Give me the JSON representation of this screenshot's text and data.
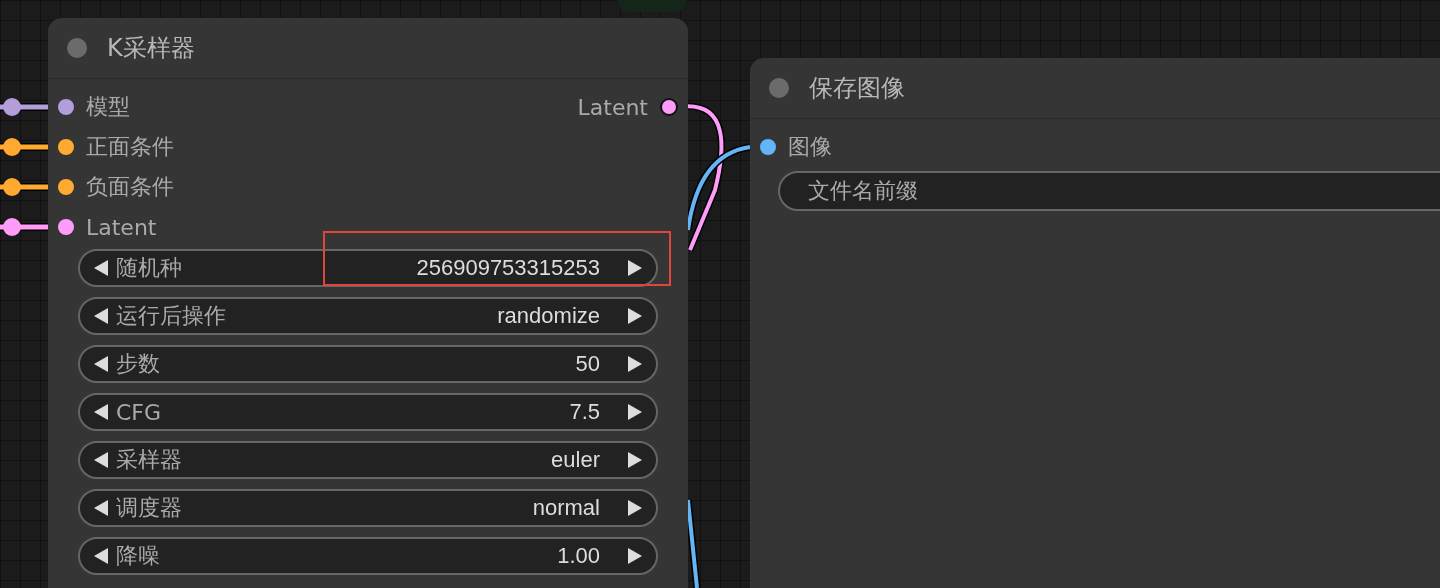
{
  "nodes": [
    {
      "title": "K采样器",
      "inputs": [
        {
          "label": "模型",
          "color": "#b39ddb"
        },
        {
          "label": "正面条件",
          "color": "#ffa931"
        },
        {
          "label": "负面条件",
          "color": "#ffa931"
        },
        {
          "label": "Latent",
          "color": "#ff9cf9"
        }
      ],
      "outputs": [
        {
          "label": "Latent",
          "color": "#ff9cf9"
        }
      ],
      "widgets": [
        {
          "kind": "number",
          "label": "随机种",
          "value": "256909753315253",
          "highlighted": true
        },
        {
          "kind": "combo",
          "label": "运行后操作",
          "value": "randomize",
          "highlighted": false
        },
        {
          "kind": "number",
          "label": "步数",
          "value": "50",
          "highlighted": false
        },
        {
          "kind": "number",
          "label": "CFG",
          "value": "7.5",
          "highlighted": false
        },
        {
          "kind": "combo",
          "label": "采样器",
          "value": "euler",
          "highlighted": false
        },
        {
          "kind": "combo",
          "label": "调度器",
          "value": "normal",
          "highlighted": false
        },
        {
          "kind": "number",
          "label": "降噪",
          "value": "1.00",
          "highlighted": false
        }
      ]
    },
    {
      "title": "保存图像",
      "inputs": [
        {
          "label": "图像",
          "color": "#64b5f6"
        }
      ],
      "widgets": [
        {
          "kind": "text",
          "label": "文件名前缀",
          "highlighted": false
        }
      ]
    }
  ]
}
